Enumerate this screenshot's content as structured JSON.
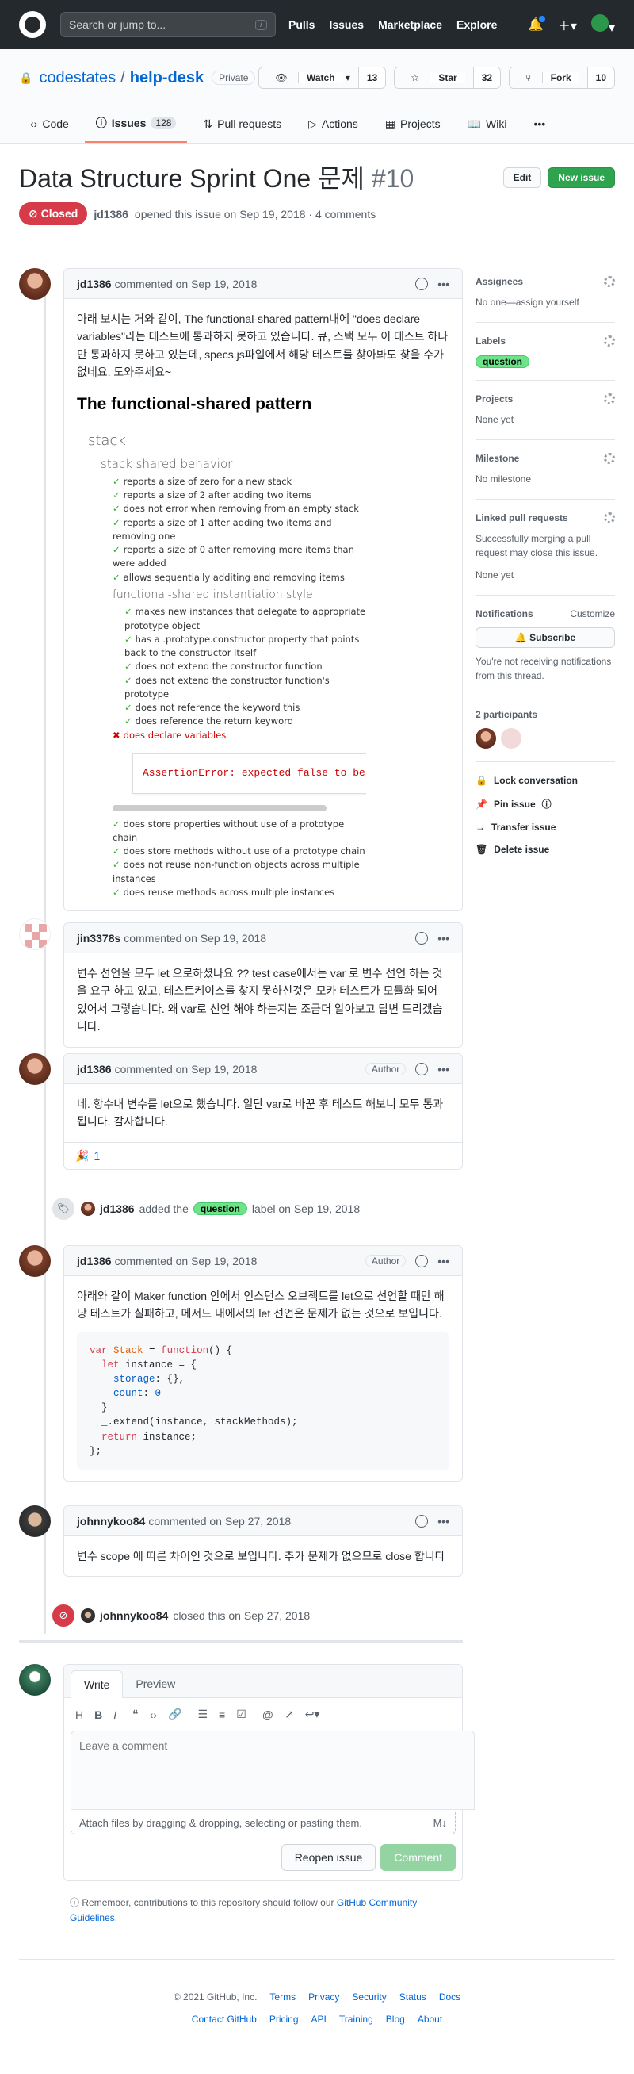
{
  "header": {
    "search_placeholder": "Search or jump to...",
    "search_kbd": "/",
    "nav": [
      "Pulls",
      "Issues",
      "Marketplace",
      "Explore"
    ]
  },
  "repo": {
    "owner": "codestates",
    "name": "help-desk",
    "visibility": "Private",
    "watch": {
      "label": "Watch",
      "count": "13"
    },
    "star": {
      "label": "Star",
      "count": "32"
    },
    "fork": {
      "label": "Fork",
      "count": "10"
    },
    "tabs": [
      {
        "label": "Code"
      },
      {
        "label": "Issues",
        "count": "128"
      },
      {
        "label": "Pull requests"
      },
      {
        "label": "Actions"
      },
      {
        "label": "Projects"
      },
      {
        "label": "Wiki"
      }
    ]
  },
  "issue": {
    "title": "Data Structure Sprint One 문제",
    "number": "#10",
    "edit_label": "Edit",
    "new_label": "New issue",
    "state": "Closed",
    "author": "jd1386",
    "meta_text": "opened this issue on Sep 19, 2018 · 4 comments"
  },
  "comments": [
    {
      "author": "jd1386",
      "date": "commented on Sep 19, 2018",
      "body": "아래 보시는 거와 같이, The functional-shared pattern내에 \"does declare variables\"라는 테스트에 통과하지 못하고 있습니다. 큐, 스택 모두 이 테스트 하나만 통과하지 못하고 있는데, specs.js파일에서 해당 테스트를 찾아봐도 찾을 수가 없네요. 도와주세요~",
      "spec": {
        "title": "The functional-shared pattern",
        "suite": "stack",
        "group1": "stack shared behavior",
        "tests1": [
          "reports a size of zero for a new stack",
          "reports a size of 2 after adding two items",
          "does not error when removing from an empty stack",
          "reports a size of 1 after adding two items and removing one",
          "reports a size of 0 after removing more items than were added",
          "allows sequentially additing and removing items"
        ],
        "group2": "functional-shared instantiation style",
        "tests2": [
          "makes new instances that delegate to appropriate prototype object",
          "has a .prototype.constructor property that points back to the constructor itself",
          "does not extend the constructor function",
          "does not extend the constructor function's prototype",
          "does not reference the keyword this",
          "does reference the return keyword"
        ],
        "failed": "does declare variables",
        "error": "AssertionError: expected false to be true",
        "tests3": [
          "does store properties without use of a prototype chain",
          "does store methods without use of a prototype chain",
          "does not reuse non-function objects across multiple instances",
          "does reuse methods across multiple instances"
        ]
      }
    },
    {
      "author": "jin3378s",
      "date": "commented on Sep 19, 2018",
      "body": "변수 선언을 모두 let 으로하셨나요 ?? test case에서는 var 로 변수 선언 하는 것을 요구 하고 있고, 테스트케이스를 찾지 못하신것은 모카 테스트가 모듈화 되어 있어서 그렇습니다. 왜 var로 선언 해야 하는지는 조금더 알아보고 답변 드리겠습니다."
    },
    {
      "author": "jd1386",
      "date": "commented on Sep 19, 2018",
      "badge": "Author",
      "body": "네. 항수내 변수를 let으로 했습니다. 일단 var로 바꾼 후 테스트 해보니 모두 통과됩니다. 감사합니다.",
      "reaction": {
        "emoji": "🎉",
        "count": "1"
      }
    },
    {
      "author": "jd1386",
      "date": "commented on Sep 19, 2018",
      "badge": "Author",
      "body": "아래와 같이 Maker function 안에서 인스턴스 오브젝트를 let으로 선언할 때만 해당 테스트가 실패하고, 메서드 내에서의 let 선언은 문제가 없는 것으로 보입니다.",
      "code": [
        "var Stack = function() {",
        "  let instance = {",
        "    storage: {},",
        "    count: 0",
        "  }",
        "  _.extend(instance, stackMethods);",
        "  return instance;",
        "};"
      ]
    },
    {
      "author": "johnnykoo84",
      "date": "commented on Sep 27, 2018",
      "body": "변수 scope 에 따른 차이인 것으로 보입니다. 추가 문제가 없으므로 close 합니다"
    }
  ],
  "events": {
    "label_event": {
      "actor": "jd1386",
      "pre": "added the",
      "label": "question",
      "post": "label on Sep 19, 2018"
    },
    "close_event": {
      "actor": "johnnykoo84",
      "text": "closed this on Sep 27, 2018"
    }
  },
  "new_comment": {
    "tab_write": "Write",
    "tab_preview": "Preview",
    "placeholder": "Leave a comment",
    "attach_text": "Attach files by dragging & dropping, selecting or pasting them.",
    "reopen_label": "Reopen issue",
    "comment_label": "Comment",
    "guideline_pre": "Remember, contributions to this repository should follow our",
    "guideline_link": "GitHub Community Guidelines."
  },
  "sidebar": {
    "assignees": {
      "title": "Assignees",
      "value": "No one—assign yourself"
    },
    "labels": {
      "title": "Labels",
      "value": "question"
    },
    "projects": {
      "title": "Projects",
      "value": "None yet"
    },
    "milestone": {
      "title": "Milestone",
      "value": "No milestone"
    },
    "linked": {
      "title": "Linked pull requests",
      "value": "Successfully merging a pull request may close this issue.",
      "value2": "None yet"
    },
    "notifications": {
      "title": "Notifications",
      "customize": "Customize",
      "button": "Subscribe",
      "note": "You're not receiving notifications from this thread."
    },
    "participants": {
      "title": "2 participants"
    },
    "actions": [
      "Lock conversation",
      "Pin issue",
      "Transfer issue",
      "Delete issue"
    ]
  },
  "footer": {
    "copyright": "© 2021 GitHub, Inc.",
    "row1": [
      "Terms",
      "Privacy",
      "Security",
      "Status",
      "Docs"
    ],
    "row2": [
      "Contact GitHub",
      "Pricing",
      "API",
      "Training",
      "Blog",
      "About"
    ]
  },
  "colors": {
    "closed": "#d73a49",
    "primary": "#2ea44f",
    "link": "#0366d6",
    "label": "#6ee48a"
  }
}
